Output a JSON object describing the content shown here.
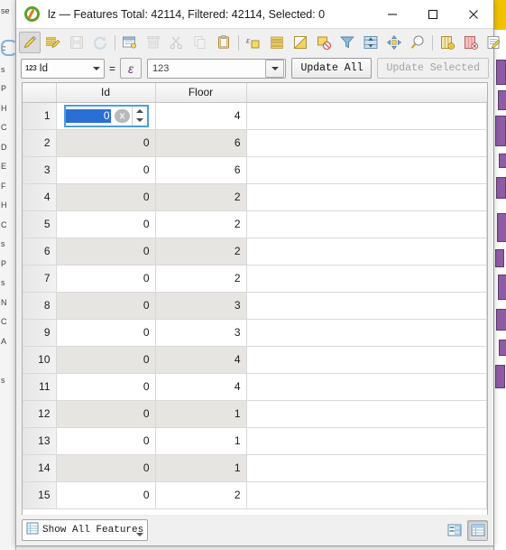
{
  "window": {
    "app_icon": "qgis-logo-icon",
    "title": "lz — Features Total: 42114, Filtered: 42114, Selected: 0",
    "minimize_label": "minimize-icon",
    "maximize_label": "maximize-icon",
    "close_label": "close-icon"
  },
  "toolbar": {
    "buttons": [
      {
        "name": "toggle-editing",
        "icon": "pencil-icon",
        "state": "active"
      },
      {
        "name": "save-edits",
        "icon": "multi-edit-icon",
        "state": "enabled"
      },
      {
        "name": "save-layer-edits",
        "icon": "floppy-disk-icon",
        "state": "disabled"
      },
      {
        "name": "reload-table",
        "icon": "refresh-icon",
        "state": "disabled"
      },
      {
        "sep": true
      },
      {
        "name": "add-feature",
        "icon": "new-record-icon",
        "state": "enabled"
      },
      {
        "name": "delete-selected-features",
        "icon": "trash-icon",
        "state": "disabled"
      },
      {
        "name": "cut-features",
        "icon": "scissors-icon",
        "state": "disabled"
      },
      {
        "name": "copy-features",
        "icon": "copy-icon",
        "state": "disabled"
      },
      {
        "name": "paste-features",
        "icon": "clipboard-icon",
        "state": "enabled"
      },
      {
        "sep": true
      },
      {
        "name": "select-by-expression",
        "icon": "expression-select-icon",
        "state": "enabled"
      },
      {
        "name": "select-all",
        "icon": "select-all-icon",
        "state": "enabled"
      },
      {
        "name": "invert-selection",
        "icon": "invert-selection-icon",
        "state": "enabled"
      },
      {
        "name": "deselect-all",
        "icon": "deselect-all-icon",
        "state": "enabled"
      },
      {
        "name": "filter-features",
        "icon": "funnel-icon",
        "state": "enabled"
      },
      {
        "name": "move-selection-to-top",
        "icon": "move-to-top-icon",
        "state": "enabled"
      },
      {
        "name": "pan-map-to-feature",
        "icon": "pan-map-icon",
        "state": "enabled"
      },
      {
        "name": "zoom-map-to-feature",
        "icon": "magnifier-icon",
        "state": "enabled"
      },
      {
        "sep": true
      },
      {
        "name": "new-field",
        "icon": "add-column-icon",
        "state": "enabled"
      },
      {
        "name": "delete-field",
        "icon": "delete-column-icon",
        "state": "enabled"
      },
      {
        "name": "open-field-calculator",
        "icon": "field-calculator-icon",
        "state": "enabled"
      },
      {
        "name": "toolbar-overflow",
        "icon": "chevron-double-right-icon",
        "state": "enabled"
      }
    ],
    "overflow_label": "»"
  },
  "fieldbar": {
    "field_type_badge": "123",
    "field_name": "Id",
    "field_dropdown_icon": "chevron-down-icon",
    "equals_label": "=",
    "expression_button_icon": "epsilon-icon",
    "expression_button_label": "ε",
    "value": "123",
    "value_placeholder": "123",
    "value_dropdown_icon": "chevron-down-icon",
    "update_all_label": "Update All",
    "update_selected_label": "Update Selected",
    "update_selected_enabled": false
  },
  "table": {
    "columns": [
      "Id",
      "Floor"
    ],
    "editing_row_index": 0,
    "editing_cell": {
      "value": "0",
      "clear_icon": "clear-circle-icon",
      "spinner_up_icon": "chevron-up-icon",
      "spinner_down_icon": "chevron-down-icon"
    },
    "rows": [
      {
        "n": "1",
        "Id": "0",
        "Floor": "4"
      },
      {
        "n": "2",
        "Id": "0",
        "Floor": "6"
      },
      {
        "n": "3",
        "Id": "0",
        "Floor": "6"
      },
      {
        "n": "4",
        "Id": "0",
        "Floor": "2"
      },
      {
        "n": "5",
        "Id": "0",
        "Floor": "2"
      },
      {
        "n": "6",
        "Id": "0",
        "Floor": "2"
      },
      {
        "n": "7",
        "Id": "0",
        "Floor": "2"
      },
      {
        "n": "8",
        "Id": "0",
        "Floor": "3"
      },
      {
        "n": "9",
        "Id": "0",
        "Floor": "3"
      },
      {
        "n": "10",
        "Id": "0",
        "Floor": "4"
      },
      {
        "n": "11",
        "Id": "0",
        "Floor": "4"
      },
      {
        "n": "12",
        "Id": "0",
        "Floor": "1"
      },
      {
        "n": "13",
        "Id": "0",
        "Floor": "1"
      },
      {
        "n": "14",
        "Id": "0",
        "Floor": "1"
      },
      {
        "n": "15",
        "Id": "0",
        "Floor": "2"
      }
    ]
  },
  "bottombar": {
    "filter_icon": "table-icon",
    "filter_label": "Show All Features",
    "filter_dropdown_icon": "chevron-down-icon",
    "form_view_icon": "form-view-icon",
    "table_view_icon": "table-view-icon",
    "active_view": "table"
  },
  "backdrop": {
    "left_panel_text": "se\n\nF\ns\nP\nH\nC\nD\nE\nF\nH\nC\ns\nP\ns\nN\nC\nA\n\ns"
  }
}
